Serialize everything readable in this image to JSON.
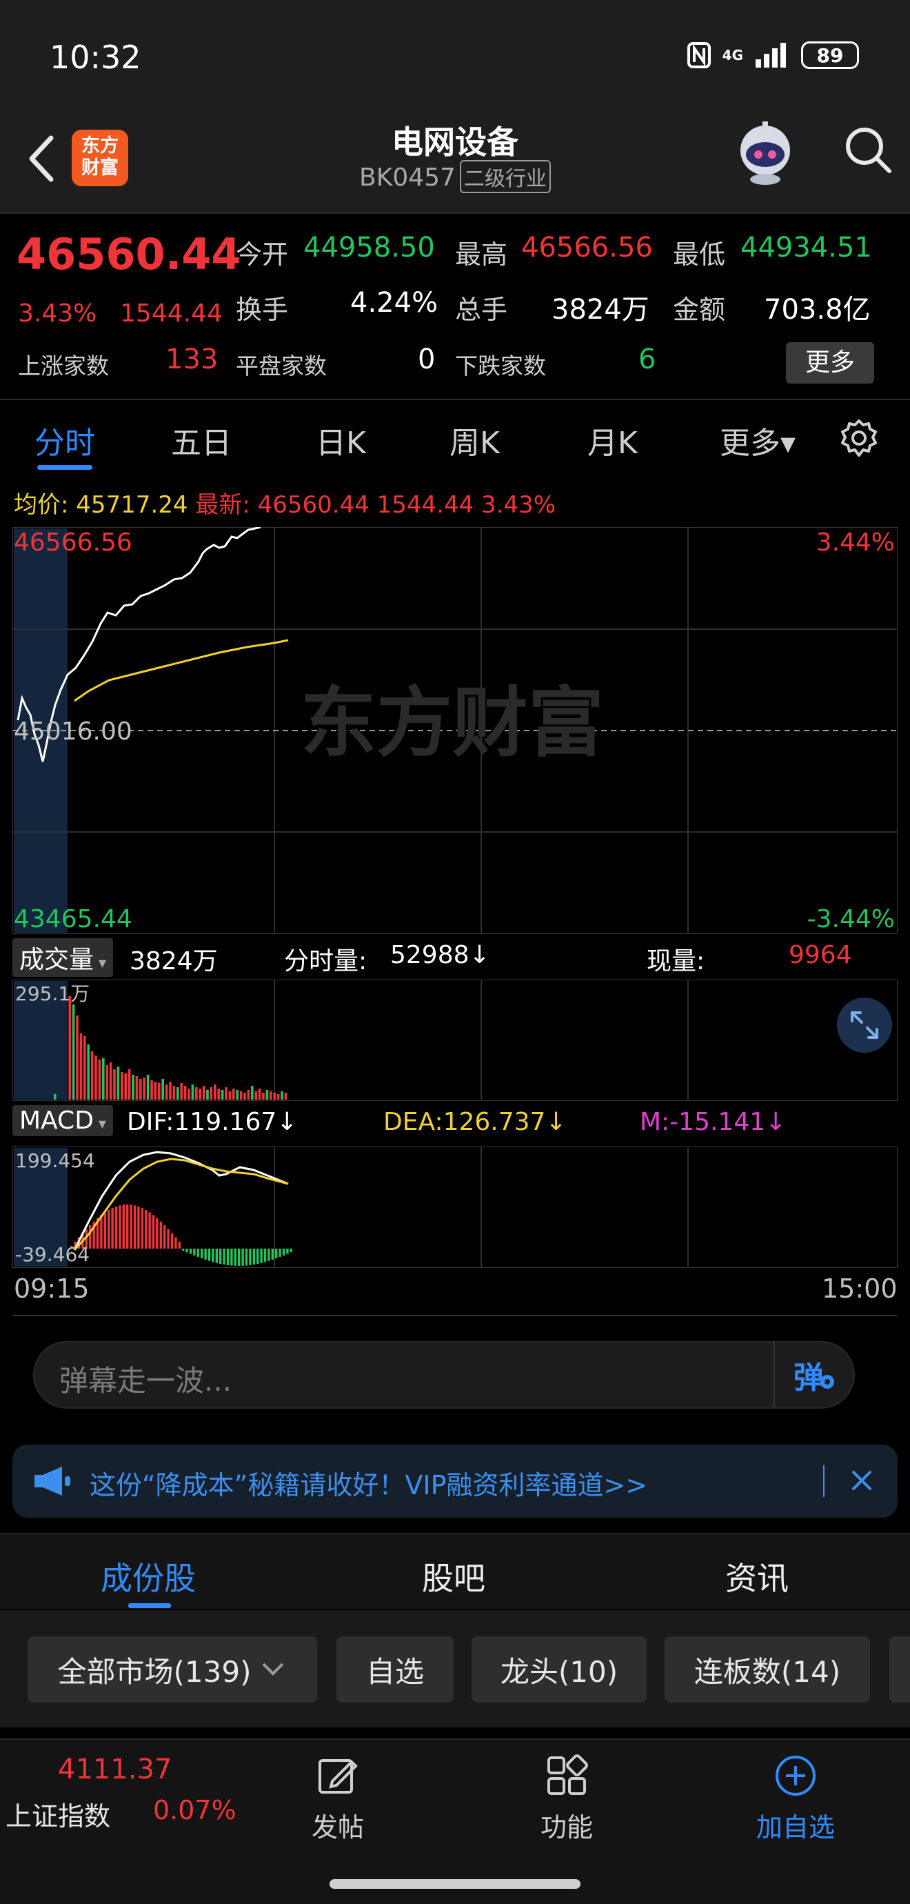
{
  "status": {
    "time": "10:32",
    "network": "4G",
    "battery": "89"
  },
  "header": {
    "logo_line1": "东方",
    "logo_line2": "财富",
    "title": "电网设备",
    "code": "BK0457",
    "tag": "二级行业"
  },
  "quote": {
    "price": "46560.44",
    "pct": "3.43%",
    "change": "1544.44",
    "open_label": "今开",
    "open": "44958.50",
    "high_label": "最高",
    "high": "46566.56",
    "low_label": "最低",
    "low": "44934.51",
    "turnover_label": "换手",
    "turnover": "4.24%",
    "volume_label": "总手",
    "volume": "3824万",
    "amount_label": "金额",
    "amount": "703.8亿",
    "up_label": "上涨家数",
    "up": "133",
    "flat_label": "平盘家数",
    "flat": "0",
    "down_label": "下跌家数",
    "down": "6",
    "more_label": "更多"
  },
  "tabs": [
    "分时",
    "五日",
    "日K",
    "周K",
    "月K",
    "更多▾"
  ],
  "legend": {
    "avg_label": "均价:",
    "avg": "45717.24",
    "latest_label": "最新:",
    "latest": "46560.44 1544.44 3.43%"
  },
  "price_chart": {
    "y_top": "46566.56",
    "y_mid": "45016.00",
    "y_bottom": "43465.44",
    "pct_top": "3.44%",
    "pct_bottom": "-3.44%",
    "watermark": "东方财富"
  },
  "volume_panel": {
    "selector": "成交量",
    "total": "3824万",
    "tick_label": "分时量:",
    "tick": "52988↓",
    "now_label": "现量:",
    "now": "9964",
    "max": "295.1万"
  },
  "macd_panel": {
    "selector": "MACD",
    "dif": "DIF:119.167↓",
    "dea": "DEA:126.737↓",
    "m": "M:-15.141↓",
    "y_top": "199.454",
    "y_bottom": "-39.464"
  },
  "time_axis": {
    "start": "09:15",
    "end": "15:00"
  },
  "danmu": {
    "placeholder": "弹幕走一波...",
    "button": "弹"
  },
  "ad": {
    "text": "这份“降成本”秘籍请收好！VIP融资利率通道>>"
  },
  "subtabs": [
    "成份股",
    "股吧",
    "资讯"
  ],
  "filters": [
    "全部市场(139)",
    "自选",
    "龙头(10)",
    "连板数(14)"
  ],
  "bottom": {
    "index_value": "4111.37",
    "index_name": "上证指数",
    "index_pct": "0.07%",
    "nav": [
      "发帖",
      "功能",
      "加自选"
    ]
  },
  "colors": {
    "up": "#f0343a",
    "down": "#22c55e",
    "accent": "#2f8cff",
    "avg": "#f2d22e",
    "macd_m": "#e040d0"
  }
}
